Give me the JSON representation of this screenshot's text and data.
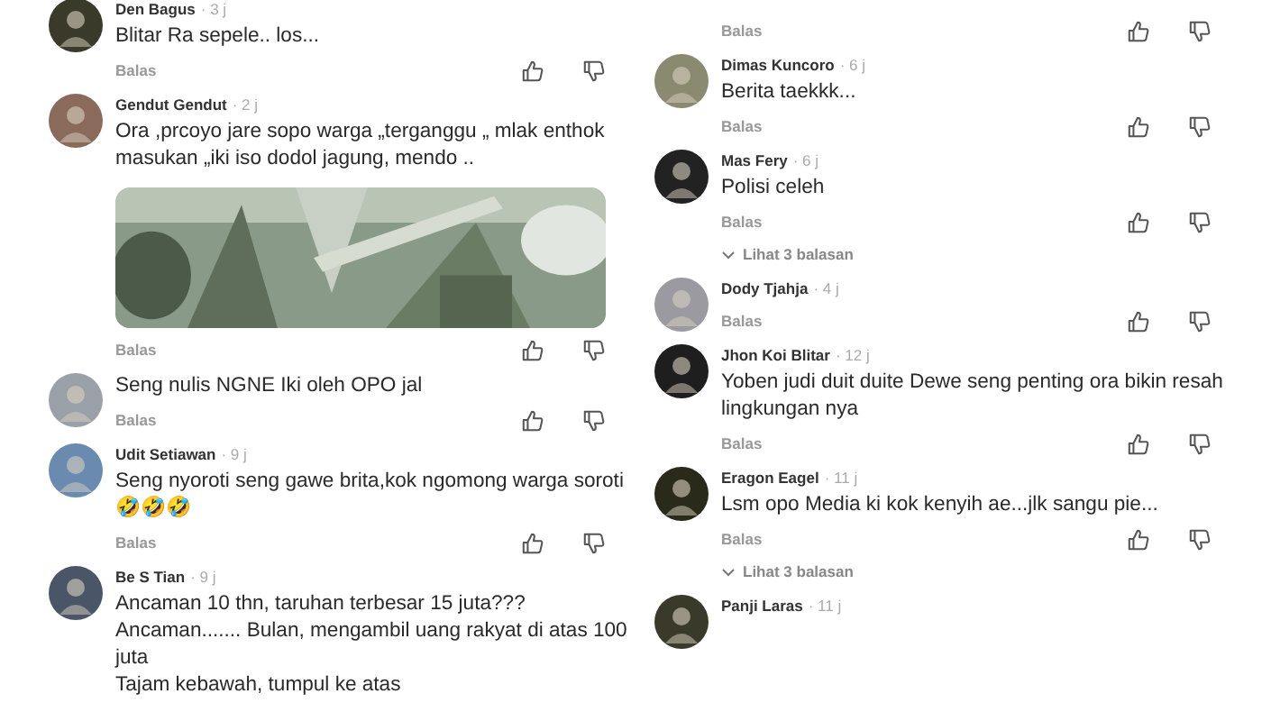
{
  "columns": [
    {
      "comments": [
        {
          "author": "Den Bagus",
          "time": "· 3 j",
          "lines": [
            "Blitar Ra sepele.. los..."
          ],
          "reply": "Balas"
        },
        {
          "author": "Gendut Gendut",
          "time": "· 2 j",
          "lines": [
            "Ora ,prcoyo  jare sopo warga „terganggu „ mlak enthok",
            "masukan „iki iso dodol jagung, mendo .."
          ],
          "reply": "Balas"
        },
        {
          "lines": [
            "Seng nulis NGNE Iki oleh OPO jal"
          ],
          "reply": "Balas"
        },
        {
          "author": "Udit Setiawan",
          "time": "· 9 j",
          "lines": [
            "Seng nyoroti seng gawe brita,kok ngomong warga soroti",
            "🤣🤣🤣"
          ],
          "reply": "Balas"
        },
        {
          "author": "Be S Tian",
          "time": "· 9 j",
          "lines": [
            "Ancaman 10 thn, taruhan terbesar 15 juta???",
            "Ancaman....... Bulan, mengambil uang rakyat di atas 100",
            "juta",
            "Tajam kebawah, tumpul ke atas"
          ]
        }
      ]
    },
    {
      "comments": [
        {
          "reply": "Balas"
        },
        {
          "author": "Dimas Kuncoro",
          "time": "· 6 j",
          "lines": [
            "Berita taekkk..."
          ],
          "reply": "Balas"
        },
        {
          "author": "Mas Fery",
          "time": "· 6 j",
          "lines": [
            "Polisi celeh"
          ],
          "reply": "Balas",
          "replies_link": "Lihat 3 balasan"
        },
        {
          "author": "Dody Tjahja",
          "time": "· 4 j",
          "reply": "Balas"
        },
        {
          "author": "Jhon Koi Blitar",
          "time": "· 12 j",
          "lines": [
            "Yoben judi duit duite Dewe seng penting ora bikin resah",
            "lingkungan nya"
          ],
          "reply": "Balas"
        },
        {
          "author": "Eragon Eagel",
          "time": "· 11 j",
          "lines": [
            "Lsm opo Media ki kok kenyih ae...jlk sangu pie..."
          ],
          "reply": "Balas",
          "replies_link": "Lihat 3 balasan"
        },
        {
          "author": "Panji Laras",
          "time": "· 11 j"
        }
      ]
    }
  ]
}
